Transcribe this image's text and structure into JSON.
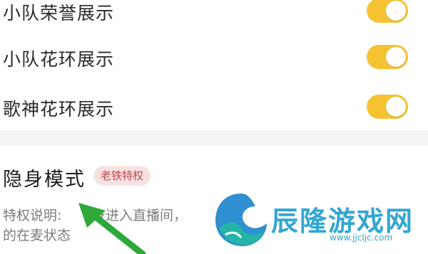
{
  "settings": {
    "items": [
      {
        "label": "小队荣誉展示",
        "enabled": true
      },
      {
        "label": "小队花环展示",
        "enabled": true
      },
      {
        "label": "歌神花环展示",
        "enabled": true
      }
    ]
  },
  "stealth": {
    "title": "隐身模式",
    "badge": "老铁特权",
    "desc_line1_a": "特权说明:",
    "desc_line1_b": "身进入直播间，",
    "desc_line2": "的在麦状态"
  },
  "watermark": {
    "text": "辰隆游戏网",
    "url": "www.jjcljc.com"
  },
  "colors": {
    "toggle_on": "#f5c332",
    "badge_bg": "#f7e2e2",
    "badge_text": "#c0474a",
    "arrow": "#2fa83a",
    "watermark": "#33a6d2"
  }
}
